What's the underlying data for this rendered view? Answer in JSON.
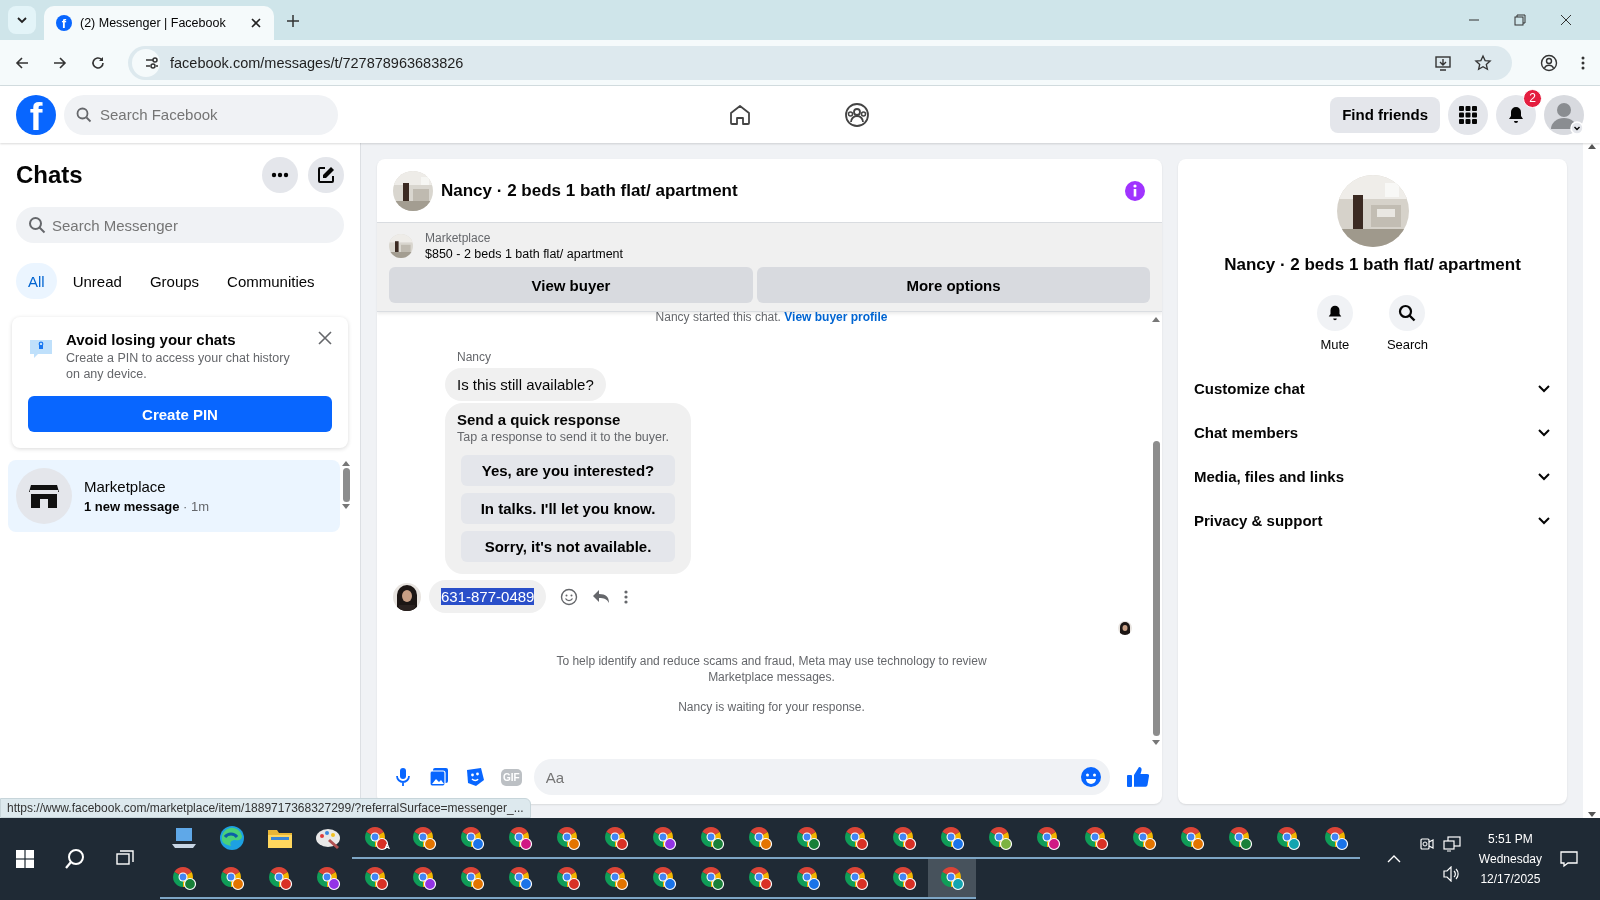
{
  "browser": {
    "favicon": "f",
    "tab_title": "(2) Messenger | Facebook",
    "url": "facebook.com/messages/t/727878963683826"
  },
  "header": {
    "logo": "f",
    "search_placeholder": "Search Facebook",
    "find_friends": "Find friends",
    "notification_count": "2"
  },
  "chats": {
    "title": "Chats",
    "search_placeholder": "Search Messenger",
    "filters": [
      {
        "label": "All",
        "selected": true
      },
      {
        "label": "Unread",
        "selected": false
      },
      {
        "label": "Groups",
        "selected": false
      },
      {
        "label": "Communities",
        "selected": false
      }
    ],
    "pin_card": {
      "title": "Avoid losing your chats",
      "text": "Create a PIN to access your chat history on any device.",
      "button": "Create PIN"
    },
    "items": [
      {
        "name": "Marketplace",
        "preview": "1 new message",
        "separator": "·",
        "time": "1m",
        "selected": true,
        "unread": true
      }
    ]
  },
  "conversation": {
    "title": "Nancy · 2 beds 1 bath flat/ apartment",
    "listing": {
      "source": "Marketplace",
      "text": "$850 - 2 beds 1 bath flat/ apartment"
    },
    "buttons": [
      "View buyer",
      "More options"
    ],
    "started": {
      "text": "Nancy started this chat.",
      "link": "View buyer profile"
    },
    "sender": "Nancy",
    "message": "Is this still available?",
    "quick": {
      "title": "Send a quick response",
      "hint": "Tap a response to send it to the buyer.",
      "options": [
        "Yes, are you interested?",
        "In talks. I'll let you know.",
        "Sorry, it's not available."
      ]
    },
    "reply": {
      "text": "631-877-0489",
      "highlighted": true
    },
    "notice": "To help identify and reduce scams and fraud, Meta may use technology to review Marketplace messages.",
    "waiting": "Nancy is waiting for your response.",
    "gif": "GIF",
    "composer_placeholder": "Aa"
  },
  "details": {
    "title": "Nancy · 2 beds 1 bath flat/ apartment",
    "actions": [
      {
        "kind": "bell",
        "label": "Mute"
      },
      {
        "kind": "search",
        "label": "Search"
      }
    ],
    "sections": [
      {
        "label": "Customize chat",
        "expanded": false
      },
      {
        "label": "Chat members",
        "expanded": false
      },
      {
        "label": "Media, files and links",
        "expanded": false
      },
      {
        "label": "Privacy & support",
        "expanded": false
      }
    ]
  },
  "status_url": "https://www.facebook.com/marketplace/item/1889717368327299/?referralSurface=messenger_...",
  "taskbar": {
    "time": "5:51 PM",
    "day": "Wednesday",
    "date": "12/17/2025",
    "pinned": [
      {
        "kind": "laptop"
      },
      {
        "kind": "edge"
      },
      {
        "kind": "folder"
      },
      {
        "kind": "paint"
      }
    ],
    "rows": [
      [
        {
          "color": "#d93025",
          "badge": "A",
          "selected": false
        },
        {
          "color": "#e37400",
          "selected": false
        },
        {
          "color": "#1a73e8",
          "selected": false
        },
        {
          "color": "#d01884",
          "selected": false
        },
        {
          "color": "#e37400",
          "selected": false
        },
        {
          "color": "#d93025",
          "selected": false
        },
        {
          "color": "#9334e6",
          "selected": false
        },
        {
          "color": "#188038",
          "selected": false
        },
        {
          "color": "#e37400",
          "selected": false
        },
        {
          "color": "#188038",
          "selected": false
        },
        {
          "color": "#d93025",
          "selected": false
        },
        {
          "color": "#d93025",
          "selected": false
        },
        {
          "color": "#1a73e8",
          "selected": false
        },
        {
          "color": "#7cb342",
          "selected": false
        },
        {
          "color": "#d01884",
          "selected": false
        },
        {
          "color": "#d93025",
          "selected": false
        },
        {
          "color": "#e37400",
          "selected": false
        },
        {
          "color": "#e37400",
          "selected": false
        },
        {
          "color": "#188038",
          "selected": false
        },
        {
          "color": "#12a4af",
          "selected": false
        },
        {
          "color": "#1a73e8",
          "selected": false
        }
      ],
      [
        {
          "color": "#188038",
          "selected": false
        },
        {
          "color": "#e37400",
          "selected": false
        },
        {
          "color": "#d93025",
          "selected": false
        },
        {
          "color": "#9334e6",
          "selected": false
        },
        {
          "color": "#d93025",
          "selected": false
        },
        {
          "color": "#9334e6",
          "selected": false
        },
        {
          "color": "#e37400",
          "selected": false
        },
        {
          "color": "#1a73e8",
          "selected": false
        },
        {
          "color": "#d93025",
          "selected": false
        },
        {
          "color": "#e37400",
          "selected": false
        },
        {
          "color": "#1a73e8",
          "selected": false
        },
        {
          "color": "#188038",
          "selected": false
        },
        {
          "color": "#d93025",
          "selected": false
        },
        {
          "color": "#1a73e8",
          "selected": false
        },
        {
          "color": "#d93025",
          "selected": false
        },
        {
          "color": "#d93025",
          "selected": false
        },
        {
          "color": "#12a4af",
          "selected": true
        }
      ]
    ]
  }
}
